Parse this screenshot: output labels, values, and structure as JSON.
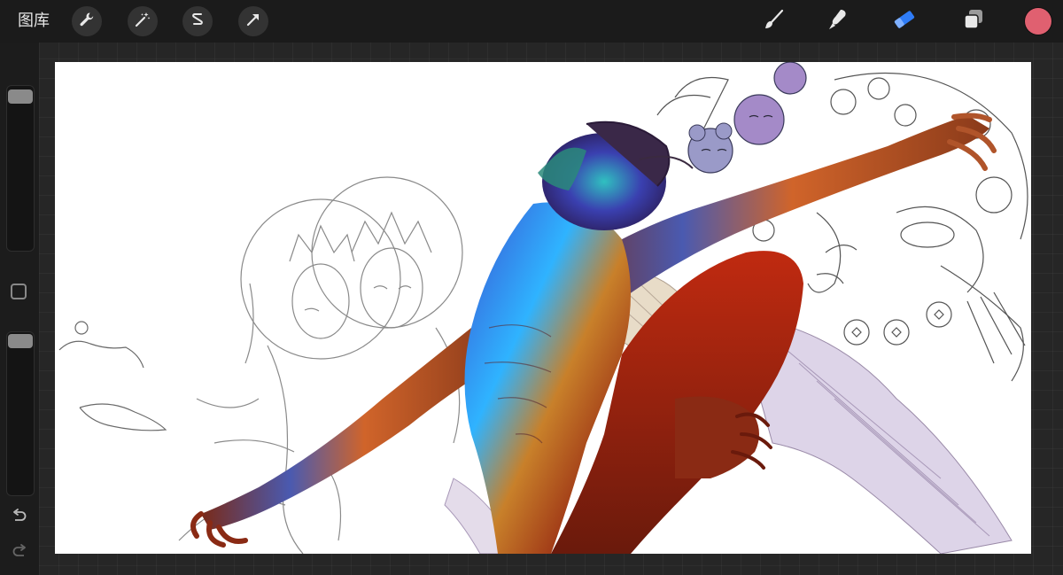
{
  "topbar": {
    "gallery_label": "图库",
    "left_tools": [
      "wrench-icon",
      "magic-wand-icon",
      "selection-icon",
      "transform-arrow-icon"
    ],
    "right_tools": [
      "brush-icon",
      "smudge-icon",
      "eraser-icon",
      "layers-icon"
    ],
    "active_tool": "eraser-icon",
    "current_color": "#e06070"
  },
  "sidebar": {
    "brush_size_level": 0.03,
    "opacity_level": 0.03
  },
  "colors": {
    "accent": "#2f7cf6",
    "canvas_bg": "#ffffff"
  }
}
